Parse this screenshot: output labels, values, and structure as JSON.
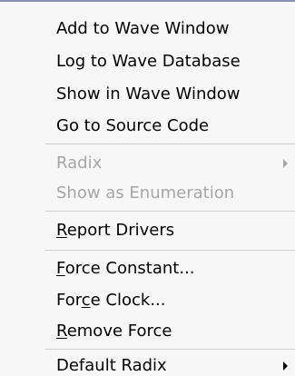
{
  "menu": {
    "items": [
      {
        "label": "Add to Wave Window"
      },
      {
        "label": "Log to Wave Database"
      },
      {
        "label": "Show in Wave Window"
      },
      {
        "label": "Go to Source Code"
      },
      {
        "label": "Radix",
        "disabled": true,
        "submenu": true
      },
      {
        "label": "Show as Enumeration",
        "disabled": true
      },
      {
        "label_pre": "",
        "label_mnemonic": "R",
        "label_post": "eport Drivers"
      },
      {
        "label_pre": "",
        "label_mnemonic": "F",
        "label_post": "orce Constant..."
      },
      {
        "label_pre": "For",
        "label_mnemonic": "c",
        "label_post": "e Clock..."
      },
      {
        "label_pre": "",
        "label_mnemonic": "R",
        "label_post": "emove Force"
      },
      {
        "label": "Default Radix",
        "submenu": true
      }
    ],
    "colors": {
      "enabled_text": "#000000",
      "disabled_text": "#a6a6a6",
      "separator": "#cfcfcf",
      "background": "#f7f7f7"
    },
    "icons": {
      "submenu_arrow": "chevron-right-icon"
    }
  }
}
